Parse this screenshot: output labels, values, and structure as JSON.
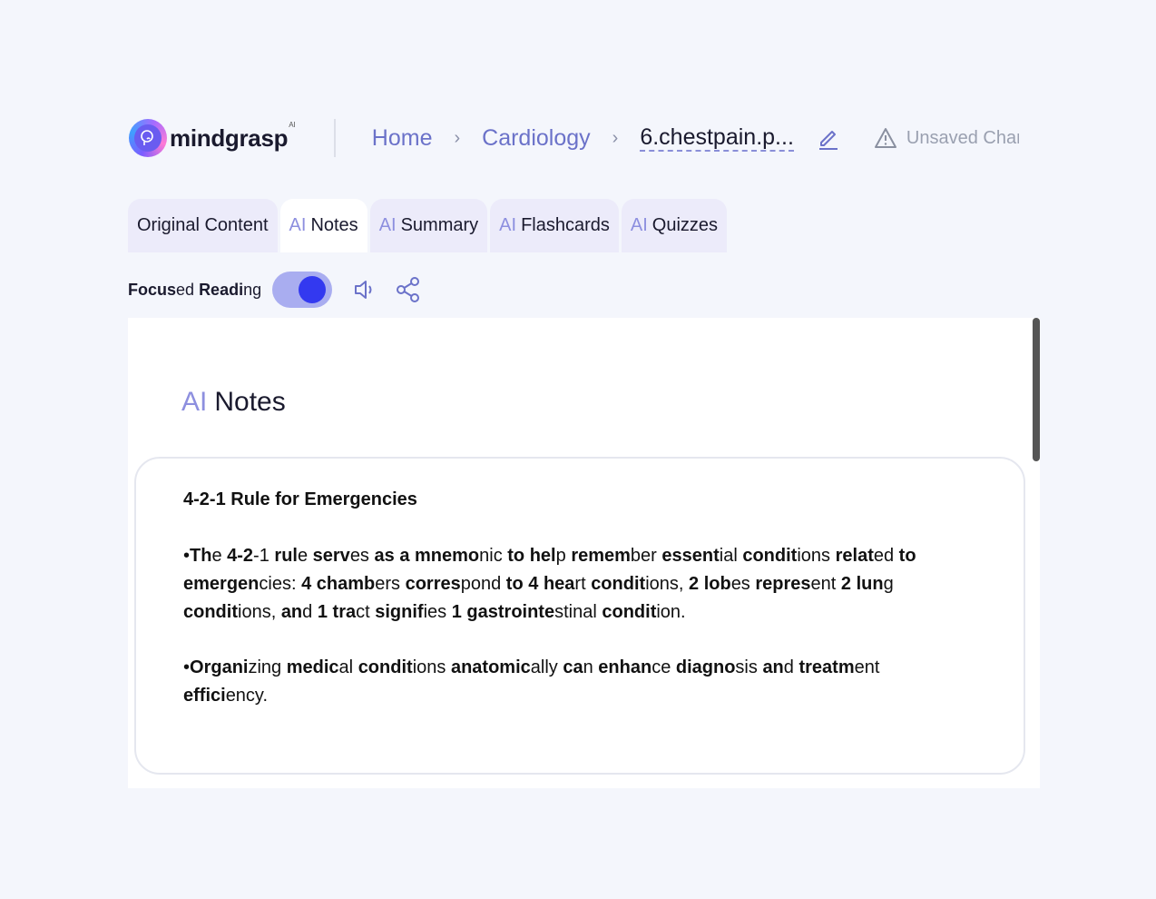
{
  "header": {
    "logo_text": "mindgrasp",
    "logo_sup": "AI",
    "breadcrumbs": [
      "Home",
      "Cardiology"
    ],
    "current_file": "6.chestpain.p...",
    "unsaved_label": "Unsaved Changes"
  },
  "tabs": [
    {
      "prefix": "",
      "label": "Original Content"
    },
    {
      "prefix": "AI",
      "label": "Notes"
    },
    {
      "prefix": "AI",
      "label": "Summary"
    },
    {
      "prefix": "AI",
      "label": "Flashcards"
    },
    {
      "prefix": "AI",
      "label": "Quizzes"
    }
  ],
  "toolbar": {
    "focus_label": "Focused Reading",
    "focus_enabled": true
  },
  "notes": {
    "title_prefix": "AI",
    "title": "Notes",
    "heading": "4-2-1 Rule for Emergencies",
    "para1": "•The 4-2-1 rule serves as a mnemonic to help remember essential conditions related to emergencies: 4 chambers correspond to 4 heart conditions, 2 lobes represent 2 lung conditions, and 1 tract signifies 1 gastrointestinal condition.",
    "para2": "•Organizing medical conditions anatomically can enhance diagnosis and treatment efficiency."
  },
  "colors": {
    "accent": "#6b72c9",
    "toggle_knob": "#3339f0",
    "background": "#f4f6fc"
  }
}
